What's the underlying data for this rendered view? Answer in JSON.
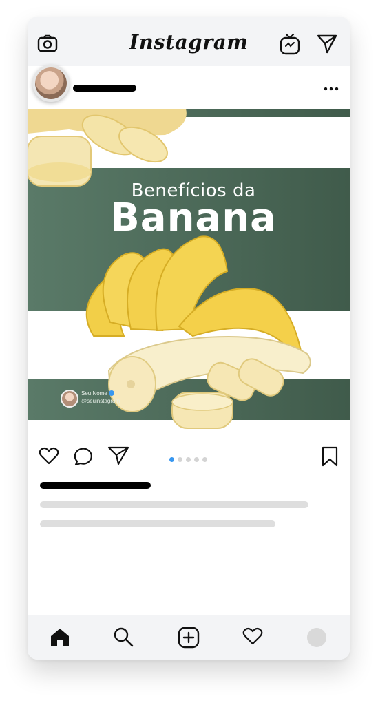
{
  "app": {
    "title": "Instagram"
  },
  "header": {
    "icons": [
      "camera-icon",
      "igtv-icon",
      "direct-send-icon"
    ]
  },
  "post": {
    "menu_icon": "more-options-icon",
    "title_small": "Benefícios da",
    "title_big": "Banana",
    "credit_name": "Seu Nome",
    "credit_handle": "@seuinstagram",
    "colors": {
      "green_dark": "#3f5a4a",
      "green_light": "#5a7a68",
      "banana": "#f2d25a"
    },
    "carousel": {
      "total": 5,
      "active_index": 0
    }
  },
  "actions": {
    "icons": [
      "heart-icon",
      "comment-icon",
      "share-icon",
      "bookmark-icon"
    ],
    "accent": "#3897f0"
  },
  "bottom_nav": {
    "icons": [
      "home-icon",
      "search-icon",
      "new-post-icon",
      "activity-heart-icon",
      "profile-avatar"
    ]
  }
}
